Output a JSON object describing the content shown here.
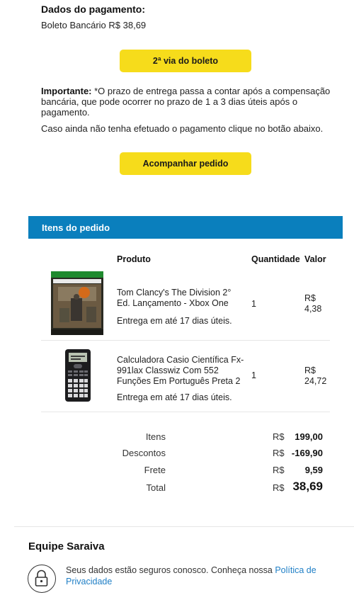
{
  "payment": {
    "heading": "Dados do pagamento:",
    "line": "Boleto Bancário R$ 38,69",
    "boleto_button": "2ª via do boleto"
  },
  "notice": {
    "important_label": "Importante:",
    "important_text": "*O prazo de entrega passa a contar após a compensação bancária, que pode ocorrer no prazo de 1 a 3 dias úteis após o pagamento.",
    "caso_text": "Caso ainda não tenha efetuado o pagamento clique no botão abaixo.",
    "track_button": "Acompanhar pedido"
  },
  "items_section": {
    "title": "Itens do pedido",
    "headers": {
      "product": "Produto",
      "quantity": "Quantidade",
      "value": "Valor"
    },
    "items": [
      {
        "name": "Tom Clancy's The Division 2° Ed. Lançamento - Xbox One",
        "delivery": "Entrega em até 17 dias úteis.",
        "quantity": "1",
        "currency": "R$",
        "value": "4,38",
        "image_icon": "game-box-icon"
      },
      {
        "name": "Calculadora Casio Científica Fx-991lax Classwiz Com 552 Funções Em Português Preta 2",
        "delivery": "Entrega em até 17 dias úteis.",
        "quantity": "1",
        "currency": "R$",
        "value": "24,72",
        "image_icon": "calculator-icon"
      }
    ]
  },
  "totals": {
    "rows": [
      {
        "label": "Itens",
        "currency": "R$",
        "value": "199,00"
      },
      {
        "label": "Descontos",
        "currency": "R$",
        "value": "-169,90"
      },
      {
        "label": "Frete",
        "currency": "R$",
        "value": "9,59"
      },
      {
        "label": "Total",
        "currency": "R$",
        "value": "38,69"
      }
    ]
  },
  "footer": {
    "team": "Equipe Saraiva",
    "secure_text": "Seus dados estão seguros conosco. Conheça nossa",
    "policy_link": "Política de Privacidade"
  },
  "colors": {
    "accent_yellow": "#f6dc1b",
    "bar_blue": "#0a7fbd",
    "link_blue": "#1f7fc6"
  }
}
